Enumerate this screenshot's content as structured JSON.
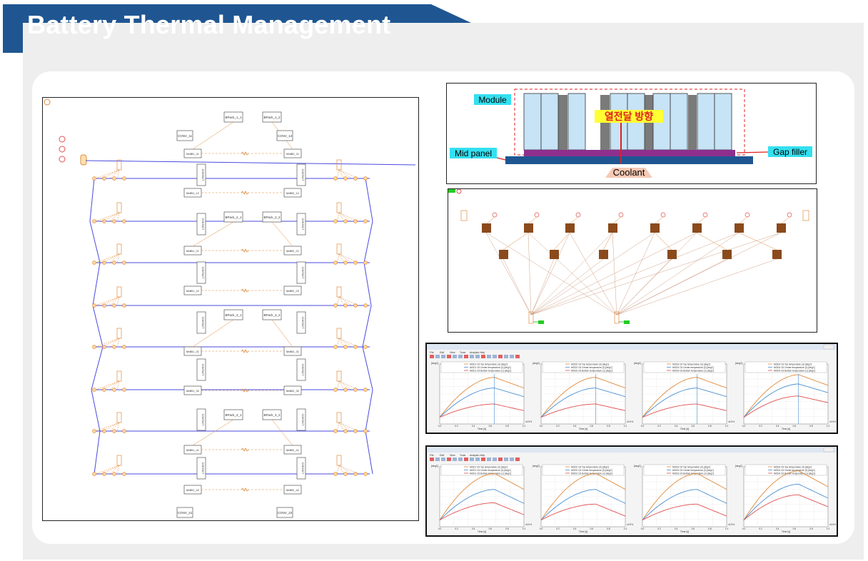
{
  "header": {
    "title": "Battery Thermal Management"
  },
  "colors": {
    "banner": "#1f5692",
    "link_blue": "#4a4adf",
    "thermal_orange": "#e08a3a",
    "mass_brown": "#8a4a1c",
    "module_fill": "#c7e3f6",
    "gap_filler": "#8e2f8e",
    "mid_panel": "#1f5692"
  },
  "network": {
    "bpack_labels": [
      "BPack_1_1",
      "BPack_1_2",
      "BPack_2_1",
      "BPack_2_2",
      "BPack_3_1",
      "BPack_3_2",
      "BPack_4_1",
      "BPack_4_2"
    ],
    "conv_labels": [
      "CONV_11",
      "CONV_12",
      "CONV_21",
      "CONV_22"
    ],
    "module_labels_left": [
      "MdlB1_11",
      "MdlB1_12",
      "MdlB1_21",
      "MdlB1_22",
      "MdlB1_31",
      "MdlB1_32",
      "MdlB1_41",
      "MdlB1_42"
    ],
    "module_labels_right": [
      "MdlB2_11",
      "MdlB2_12",
      "MdlB2_21",
      "MdlB2_22",
      "MdlB2_31",
      "MdlB2_32",
      "MdlB2_41",
      "MdlB2_42"
    ],
    "contact_label": "CONTACT"
  },
  "schematic": {
    "module_label": "Module",
    "direction_label": "열전달 방향",
    "mid_panel_label": "Mid panel",
    "gap_filler_label": "Gap filler",
    "coolant_label": "Coolant"
  },
  "plot_windows": [
    {
      "menu": [
        "File",
        "Edit",
        "View",
        "Tools",
        "Analysis",
        "Help"
      ],
      "charts": [
        {
          "ylabel": "[degC]",
          "xlabel": "Time [s]",
          "x_scale": "x10^4",
          "legend": [
            "MOD1 C6 Top temperature (3) [degC]",
            "MOD1 C6 Center temperature (2) [degC]",
            "MOD1 C6 Bottom temperature (1) [degC]"
          ],
          "peaks": [
            55,
            47,
            35
          ]
        },
        {
          "ylabel": "[degC]",
          "xlabel": "Time [s]",
          "x_scale": "x10^4",
          "legend": [
            "MOD2 C6 Top temperature (3) [degC]",
            "MOD2 C6 Center temperature (2) [degC]",
            "MOD2 C6 Bottom temperature (1) [degC]"
          ],
          "peaks": [
            55,
            47,
            35
          ]
        },
        {
          "ylabel": "[degC]",
          "xlabel": "Time [s]",
          "x_scale": "x10^4",
          "legend": [
            "MOD3 C6 Top temperature (3) [degC]",
            "MOD3 C6 Center temperature (2) [degC]",
            "MOD3 C6 Bottom temperature (1) [degC]"
          ],
          "peaks": [
            55,
            47,
            35
          ]
        },
        {
          "ylabel": "[degC]",
          "xlabel": "Time [s]",
          "x_scale": "x10^4",
          "legend": [
            "MOD4 C6 Top temperature (3) [degC]",
            "MOD4 C6 Center temperature (2) [degC]",
            "MOD4 C6 Bottom temperature (1) [degC]"
          ],
          "peaks": [
            57,
            50,
            41
          ]
        }
      ]
    },
    {
      "menu": [
        "File",
        "Edit",
        "View",
        "Tools",
        "Analysis",
        "Help"
      ],
      "charts": [
        {
          "ylabel": "[degC]",
          "xlabel": "Time [s]",
          "x_scale": "x10^4",
          "legend": [
            "MOD1 C6 Top temperature (3) [degC]",
            "MOD1 C6 Center temperature (2) [degC]",
            "MOD1 C6 Bottom temperature (1) [degC]"
          ],
          "peaks": [
            60,
            48,
            38
          ]
        },
        {
          "ylabel": "[degC]",
          "xlabel": "Time [s]",
          "x_scale": "x10^4",
          "legend": [
            "MOD2 C6 Top temperature (3) [degC]",
            "MOD2 C6 Center temperature (2) [degC]",
            "MOD2 C6 Bottom temperature (1) [degC]"
          ],
          "peaks": [
            60,
            48,
            37
          ]
        },
        {
          "ylabel": "[degC]",
          "xlabel": "Time [s]",
          "x_scale": "x10^4",
          "legend": [
            "MOD3 C6 Top temperature (3) [degC]",
            "MOD3 C6 Center temperature (2) [degC]",
            "MOD3 C6 Bottom temperature (1) [degC]"
          ],
          "peaks": [
            60,
            48,
            37
          ]
        },
        {
          "ylabel": "[degC]",
          "xlabel": "Time [s]",
          "x_scale": "x10^4",
          "legend": [
            "MOD4 C6 Top temperature (3) [degC]",
            "MOD4 C6 Center temperature (2) [degC]",
            "MOD4 C6 Bottom temperature (1) [degC]"
          ],
          "peaks": [
            62,
            52,
            44
          ]
        }
      ]
    }
  ]
}
